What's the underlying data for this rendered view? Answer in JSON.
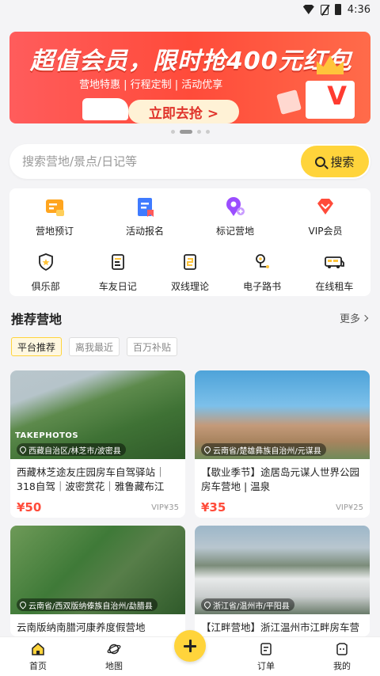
{
  "status_bar": {
    "time": "4:36"
  },
  "banner": {
    "title": "超值会员，限时抢400元红包",
    "subtitle": "营地特惠 | 行程定制 | 活动优享",
    "cta": "立即去抢 >",
    "gift_letter": "V"
  },
  "search": {
    "placeholder": "搜索营地/景点/日记等",
    "button": "搜索"
  },
  "quick_menu": {
    "row1": [
      {
        "label": "营地预订",
        "icon": "calendar-icon",
        "color": "#ffa51f"
      },
      {
        "label": "活动报名",
        "icon": "bookmark-icon",
        "color": "#3f7bff"
      },
      {
        "label": "标记营地",
        "icon": "map-pin-icon",
        "color": "#9b4dff"
      },
      {
        "label": "VIP会员",
        "icon": "diamond-icon",
        "color": "#ff4b3a"
      }
    ],
    "row2": [
      {
        "label": "俱乐部",
        "icon": "shield-star-icon"
      },
      {
        "label": "车友日记",
        "icon": "diary-icon"
      },
      {
        "label": "双线理论",
        "icon": "book-icon"
      },
      {
        "label": "电子路书",
        "icon": "route-icon"
      },
      {
        "label": "在线租车",
        "icon": "rv-icon"
      }
    ]
  },
  "recommend": {
    "title": "推荐营地",
    "more": "更多",
    "filters": [
      "平台推荐",
      "离我最近",
      "百万补贴"
    ],
    "cards": [
      {
        "location": "西藏自治区/林芝市/波密县",
        "title": "西藏林芝途友庄园房车自驾驿站｜318自驾｜波密赏花｜雅鲁藏布江",
        "price": "¥50",
        "vip": "VIP¥35",
        "watermark": "TAKEPHOTOS"
      },
      {
        "location": "云南省/楚雄彝族自治州/元谋县",
        "title": "【歇业季节】途居岛元谋人世界公园房车营地 | 温泉",
        "price": "¥35",
        "vip": "VIP¥25"
      },
      {
        "location": "云南省/西双版纳傣族自治州/勐腊县",
        "title": "云南版纳南腊河康养度假营地"
      },
      {
        "location": "浙江省/温州市/平阳县",
        "title": "【江畔营地】浙江温州市江畔房车营"
      }
    ]
  },
  "bottom_nav": [
    {
      "label": "首页",
      "icon": "home-icon"
    },
    {
      "label": "地图",
      "icon": "planet-icon"
    },
    {
      "label": "订单",
      "icon": "order-icon"
    },
    {
      "label": "我的",
      "icon": "profile-icon"
    }
  ],
  "colors": {
    "accent": "#ffd43b",
    "price": "#ff4b3a",
    "banner": "#ff5047"
  }
}
